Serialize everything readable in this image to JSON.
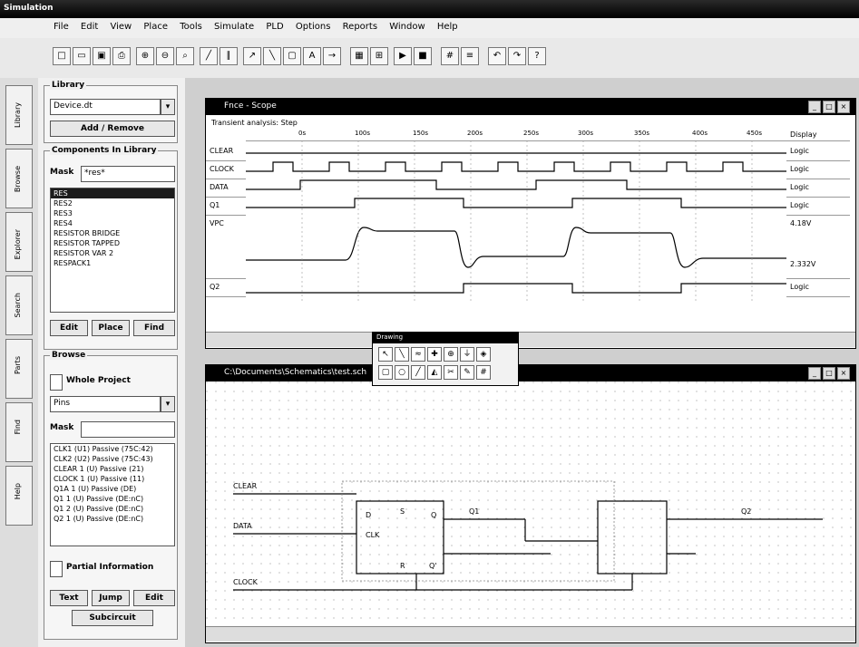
{
  "app": {
    "title": "Simulation"
  },
  "menu": [
    "File",
    "Edit",
    "View",
    "Place",
    "Tools",
    "Simulate",
    "PLD",
    "Options",
    "Reports",
    "Window",
    "Help"
  ],
  "left_tabs": [
    "Library",
    "Browse",
    "Explorer",
    "Search",
    "Parts",
    "Find",
    "Help"
  ],
  "library": {
    "title": "Library",
    "selected": "Device.dt",
    "add_remove": "Add / Remove"
  },
  "components": {
    "title": "Components In Library",
    "mask_label": "Mask",
    "mask_value": "*res*",
    "items": [
      "RES",
      "RES2",
      "RES3",
      "RES4",
      "RESISTOR BRIDGE",
      "RESISTOR TAPPED",
      "RESISTOR VAR 2",
      "RESPACK1"
    ],
    "edit": "Edit",
    "place": "Place",
    "find": "Find"
  },
  "browse": {
    "title": "Browse",
    "whole_project": "Whole Project",
    "type": "Pins",
    "mask_label": "Mask",
    "items": [
      "CLK1 (U1) Passive (75C:42)",
      "CLK2 (U2) Passive (75C:43)",
      "CLEAR 1 (U) Passive (21)",
      "CLOCK 1 (U) Passive (11)",
      "Q1A 1 (U) Passive (DE)",
      "Q1 1 (U) Passive (DE:nC)",
      "Q1 2 (U) Passive (DE:nC)",
      "Q2 1 (U) Passive (DE:nC)"
    ],
    "partial_info": "Partial Information",
    "text_btn": "Text",
    "jump_btn": "Jump",
    "edit_btn": "Edit",
    "subcircuit_btn": "Subcircuit"
  },
  "waveform": {
    "title": "Fnce - Scope",
    "subtitle": "Transient analysis: Step",
    "signals": [
      "CLEAR",
      "CLOCK",
      "DATA",
      "Q1",
      "VPC",
      "Q2"
    ],
    "ticks": [
      "0s",
      "100s",
      "150s",
      "200s",
      "250s",
      "300s",
      "350s",
      "400s",
      "450s"
    ],
    "values": [
      "Display",
      "Logic",
      "Logic",
      "Logic",
      "Logic",
      "4.18V",
      "Logic"
    ],
    "extra_value": "2.332V"
  },
  "schematic": {
    "title": "C:\\Documents\\Schematics\\test.sch",
    "labels": [
      "CLEAR",
      "DATA",
      "CLOCK",
      "Q1",
      "Q2",
      "CLK",
      "D",
      "R",
      "S",
      "Q",
      "Q'"
    ]
  },
  "palette": {
    "title": "Drawing"
  }
}
